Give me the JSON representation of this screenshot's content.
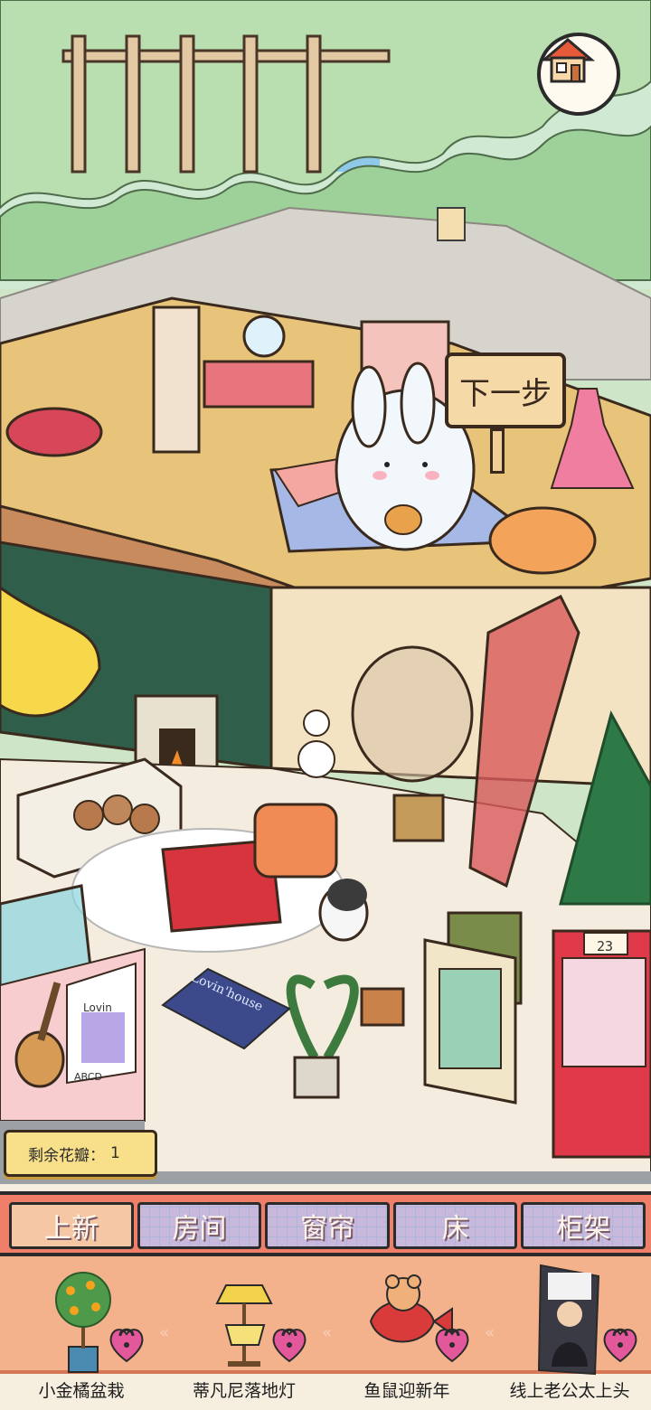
{
  "scene": {
    "next_sign": "下一步",
    "rug_text": "Lovin'house",
    "poster_name": "Lovin",
    "poster_abc": "ABCD",
    "claw_machine_number": "23"
  },
  "petals": {
    "label": "剩余花瓣：",
    "count": "1"
  },
  "tabs": [
    {
      "label": "上新",
      "active": true
    },
    {
      "label": "房间",
      "active": false
    },
    {
      "label": "窗帘",
      "active": false
    },
    {
      "label": "床",
      "active": false
    },
    {
      "label": "柜架",
      "active": false
    }
  ],
  "items": [
    {
      "name": "小金橘盆栽",
      "icon": "kumquat-bonsai-icon",
      "locked": true
    },
    {
      "name": "蒂凡尼落地灯",
      "icon": "tiffany-floor-lamp-icon",
      "locked": true
    },
    {
      "name": "鱼鼠迎新年",
      "icon": "fish-mouse-new-year-icon",
      "locked": true
    },
    {
      "name": "线上老公太上头",
      "icon": "online-husband-poster-icon",
      "locked": true
    }
  ],
  "colors": {
    "tab_bar": "#f07f69",
    "active_tab": "#f6c7a5",
    "inactive_tab": "#c8b8dc",
    "lock": "#e3579b",
    "petal_box": "#f8e08a"
  }
}
